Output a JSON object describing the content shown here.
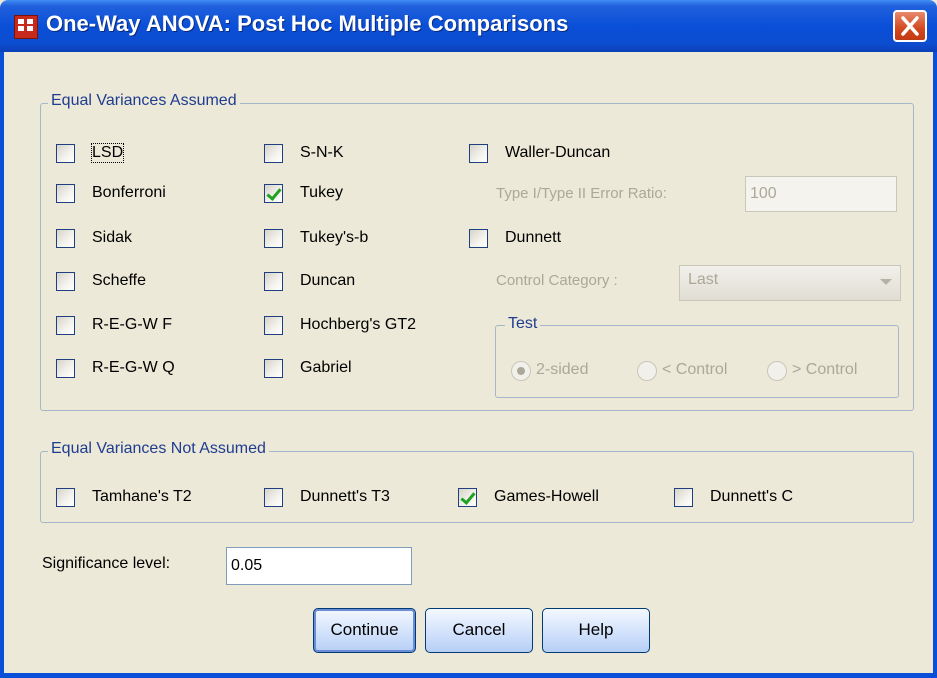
{
  "window": {
    "title": "One-Way ANOVA: Post Hoc Multiple Comparisons",
    "title_bar_color": "#0a4fd8",
    "close_icon": "close-icon"
  },
  "equal_variances_assumed": {
    "legend": "Equal Variances Assumed",
    "checkboxes": [
      {
        "label": "LSD",
        "checked": false
      },
      {
        "label": "Bonferroni",
        "checked": false
      },
      {
        "label": "Sidak",
        "checked": false
      },
      {
        "label": "Scheffe",
        "checked": false
      },
      {
        "label": "R-E-G-W F",
        "checked": false
      },
      {
        "label": "R-E-G-W Q",
        "checked": false
      },
      {
        "label": "S-N-K",
        "checked": false
      },
      {
        "label": "Tukey",
        "checked": true
      },
      {
        "label": "Tukey's-b",
        "checked": false
      },
      {
        "label": "Duncan",
        "checked": false
      },
      {
        "label": "Hochberg's GT2",
        "checked": false
      },
      {
        "label": "Gabriel",
        "checked": false
      },
      {
        "label": "Waller-Duncan",
        "checked": false
      },
      {
        "label": "Dunnett",
        "checked": false
      }
    ],
    "error_ratio_label": "Type I/Type II Error Ratio:",
    "error_ratio_value": "100",
    "control_category_label": "Control Category :",
    "control_category_value": "Last",
    "test": {
      "legend": "Test",
      "options": [
        {
          "label": "2-sided",
          "selected": true
        },
        {
          "label": "< Control",
          "selected": false
        },
        {
          "label": "> Control",
          "selected": false
        }
      ]
    }
  },
  "equal_variances_not_assumed": {
    "legend": "Equal Variances Not Assumed",
    "checkboxes": [
      {
        "label": "Tamhane's T2",
        "checked": false
      },
      {
        "label": "Dunnett's T3",
        "checked": false
      },
      {
        "label": "Games-Howell",
        "checked": true
      },
      {
        "label": "Dunnett's C",
        "checked": false
      }
    ]
  },
  "significance": {
    "label": "Significance level:",
    "value": "0.05"
  },
  "buttons": {
    "continue": "Continue",
    "cancel": "Cancel",
    "help": "Help"
  },
  "colors": {
    "dialog_bg": "#ece9d8",
    "group_label": "#1f3c8f",
    "check_mark": "#21a121",
    "disabled_text": "#aca899"
  }
}
